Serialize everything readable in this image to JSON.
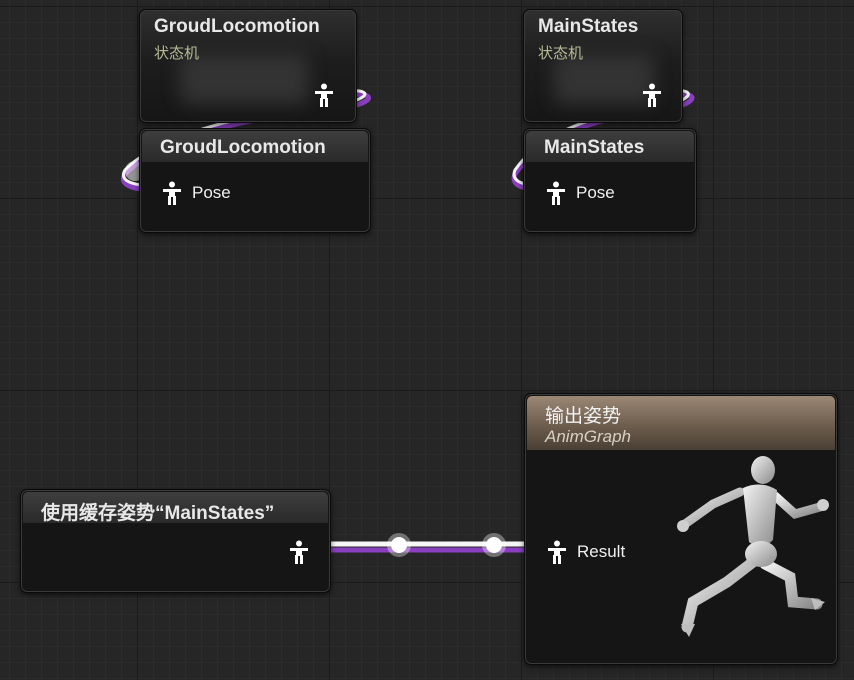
{
  "nodes": {
    "sm_groud": {
      "title": "GroudLocomotion",
      "subtitle": "状态机"
    },
    "sm_main": {
      "title": "MainStates",
      "subtitle": "状态机"
    },
    "state_groud": {
      "title": "GroudLocomotion",
      "pin_label": "Pose"
    },
    "state_main": {
      "title": "MainStates",
      "pin_label": "Pose"
    },
    "cache": {
      "title": "使用缓存姿势“MainStates”"
    },
    "output": {
      "title": "输出姿势",
      "subtitle": "AnimGraph",
      "pin_label": "Result"
    }
  },
  "icons": {
    "pose_pin": "person-pose-icon",
    "preview": "running-mannequin-icon"
  },
  "colors": {
    "background": "#262626",
    "wire_highlight": "#ffffff",
    "wire_accent": "#8a3fc0",
    "output_header": "#8c7a68",
    "subtitle": "#b6b994"
  }
}
